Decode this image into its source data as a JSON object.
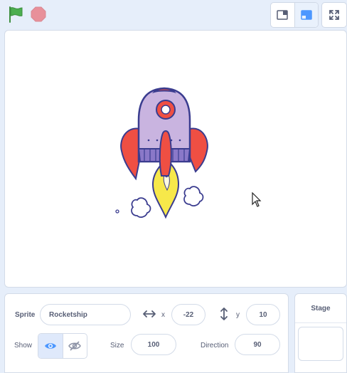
{
  "toolbar": {
    "flag_icon": "green-flag-icon",
    "stop_icon": "stop-icon",
    "colors": {
      "flag": "#4cae4f",
      "stop": "#e8909a"
    }
  },
  "stage": {
    "sprite": "Rocketship"
  },
  "sprite_info": {
    "sprite_label": "Sprite",
    "sprite_name": "Rocketship",
    "x_label": "x",
    "x_value": "-22",
    "y_label": "y",
    "y_value": "10",
    "show_label": "Show",
    "size_label": "Size",
    "size_value": "100",
    "direction_label": "Direction",
    "direction_value": "90"
  },
  "stage_panel": {
    "title": "Stage"
  }
}
